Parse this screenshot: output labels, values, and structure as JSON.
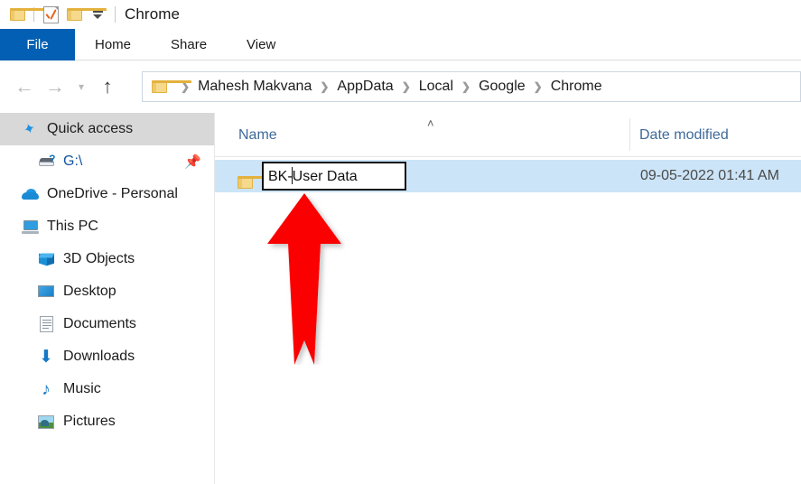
{
  "window": {
    "title": "Chrome",
    "quick_access_toolbar": [
      {
        "name": "properties-folder-icon",
        "label": "Properties"
      },
      {
        "name": "new-folder-icon",
        "label": "New folder"
      },
      {
        "name": "customize-dropdown-icon",
        "label": "Customize Quick Access Toolbar"
      }
    ]
  },
  "ribbon": {
    "file_tab": "File",
    "tabs": [
      "Home",
      "Share",
      "View"
    ]
  },
  "navigation": {
    "back_label": "Back",
    "forward_label": "Forward",
    "recent_label": "Recent locations",
    "up_label": "Up",
    "breadcrumbs": [
      "Mahesh Makvana",
      "AppData",
      "Local",
      "Google",
      "Chrome"
    ],
    "separator": "❯"
  },
  "sidebar": {
    "items": [
      {
        "label": "Quick access",
        "icon": "star-pin-icon",
        "level": 1,
        "selected": true,
        "pinned": false
      },
      {
        "label": "G:\\",
        "icon": "drive-unknown-icon",
        "level": 2,
        "selected": false,
        "pinned": true
      },
      {
        "label": "OneDrive - Personal",
        "icon": "onedrive-cloud-icon",
        "level": 1,
        "selected": false,
        "pinned": false
      },
      {
        "label": "This PC",
        "icon": "this-pc-icon",
        "level": 1,
        "selected": false,
        "pinned": false
      },
      {
        "label": "3D Objects",
        "icon": "3d-objects-icon",
        "level": 2,
        "selected": false,
        "pinned": false
      },
      {
        "label": "Desktop",
        "icon": "desktop-icon",
        "level": 2,
        "selected": false,
        "pinned": false
      },
      {
        "label": "Documents",
        "icon": "documents-icon",
        "level": 2,
        "selected": false,
        "pinned": false
      },
      {
        "label": "Downloads",
        "icon": "downloads-icon",
        "level": 2,
        "selected": false,
        "pinned": false
      },
      {
        "label": "Music",
        "icon": "music-icon",
        "level": 2,
        "selected": false,
        "pinned": false
      },
      {
        "label": "Pictures",
        "icon": "pictures-icon",
        "level": 2,
        "selected": false,
        "pinned": false
      }
    ],
    "pin_glyph": "📌"
  },
  "file_list": {
    "columns": [
      {
        "label": "Name",
        "sorted": "asc",
        "sort_glyph": "˄"
      },
      {
        "label": "Date modified",
        "sorted": "none"
      }
    ],
    "rows": [
      {
        "icon": "folder-icon",
        "name_before_caret": "BK-",
        "name_after_caret": "User Data",
        "full_name": "BK-User Data",
        "date_modified": "09-05-2022 01:41 AM",
        "selected": true,
        "renaming": true
      }
    ]
  },
  "annotation": {
    "arrow": {
      "name": "red-arrow-annotation",
      "color": "#fb0103",
      "direction": "up",
      "points_to": "rename-textbox"
    }
  },
  "colors": {
    "file_tab_blue": "#035fb3",
    "selection_blue": "#cce4f7",
    "header_text_blue": "#3f6a9a",
    "annotation_red": "#fb0103",
    "sidebar_selected_gray": "#d8d8d8"
  }
}
